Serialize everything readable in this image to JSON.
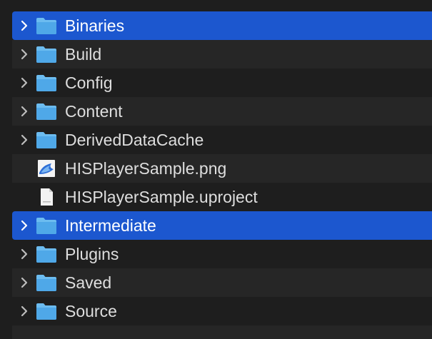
{
  "items": [
    {
      "label": "Binaries",
      "type": "folder",
      "icon": "folder-icon",
      "expandable": true,
      "selected": true
    },
    {
      "label": "Build",
      "type": "folder",
      "icon": "folder-icon",
      "expandable": true,
      "selected": false
    },
    {
      "label": "Config",
      "type": "folder",
      "icon": "folder-icon",
      "expandable": true,
      "selected": false
    },
    {
      "label": "Content",
      "type": "folder",
      "icon": "folder-icon",
      "expandable": true,
      "selected": false
    },
    {
      "label": "DerivedDataCache",
      "type": "folder",
      "icon": "folder-icon",
      "expandable": true,
      "selected": false
    },
    {
      "label": "HISPlayerSample.png",
      "type": "image",
      "icon": "image-file-icon",
      "expandable": false,
      "selected": false
    },
    {
      "label": "HISPlayerSample.uproject",
      "type": "document",
      "icon": "document-file-icon",
      "expandable": false,
      "selected": false
    },
    {
      "label": "Intermediate",
      "type": "folder",
      "icon": "folder-icon",
      "expandable": true,
      "selected": true
    },
    {
      "label": "Plugins",
      "type": "folder",
      "icon": "folder-icon",
      "expandable": true,
      "selected": false
    },
    {
      "label": "Saved",
      "type": "folder",
      "icon": "folder-icon",
      "expandable": true,
      "selected": false
    },
    {
      "label": "Source",
      "type": "folder",
      "icon": "folder-icon",
      "expandable": true,
      "selected": false
    }
  ],
  "colors": {
    "background": "#1e1e1e",
    "row_alt": "#262626",
    "selection": "#1c57cf",
    "text": "#dedede",
    "text_selected": "#ffffff",
    "folder": "#4fa8e8",
    "folder_tab": "#6cbcf0"
  }
}
